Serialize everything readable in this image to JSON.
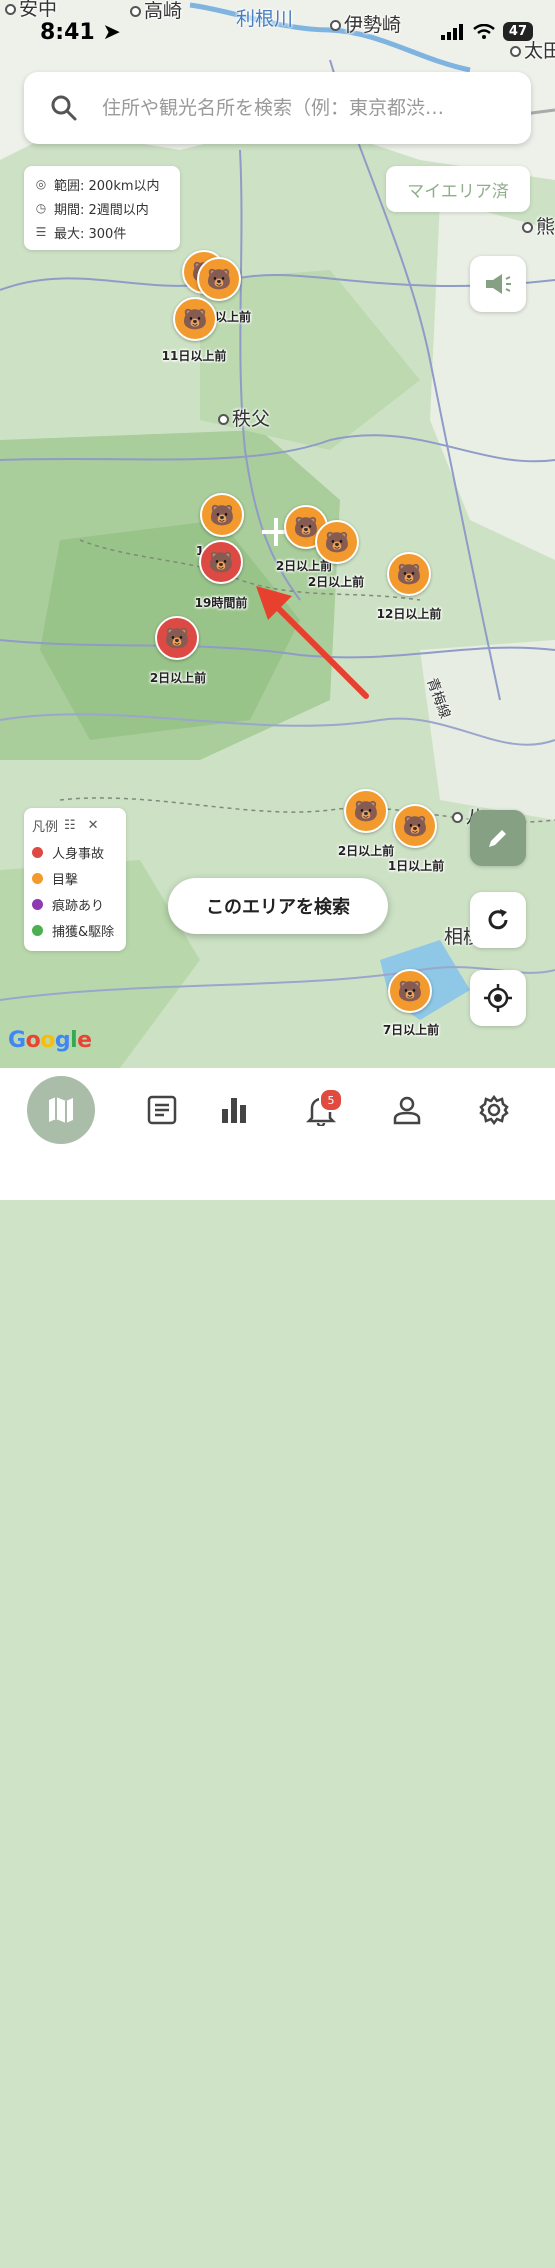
{
  "status": {
    "time": "8:41",
    "battery": "47"
  },
  "search": {
    "placeholder": "住所や観光名所を検索（例：東京都渋…"
  },
  "filter_info": {
    "range": "範囲: 200km以内",
    "period": "期間: 2週間以内",
    "max": "最大: 300件"
  },
  "my_area_label": "マイエリア済",
  "places": [
    {
      "name": "安中"
    },
    {
      "name": "高崎"
    },
    {
      "name": "利根川"
    },
    {
      "name": "伊勢崎"
    },
    {
      "name": "太田"
    },
    {
      "name": "熊"
    },
    {
      "name": "秩父"
    },
    {
      "name": "青梅線"
    },
    {
      "name": "相模"
    },
    {
      "name": "八"
    }
  ],
  "markers": [
    {
      "type": "orange",
      "label": ""
    },
    {
      "type": "orange",
      "label": "以上前"
    },
    {
      "type": "orange",
      "label": "11日以上前"
    },
    {
      "type": "orange",
      "label": "1"
    },
    {
      "type": "orange",
      "label": "2日以上前"
    },
    {
      "type": "orange",
      "label": "2日以上前"
    },
    {
      "type": "red",
      "label": "19時間前"
    },
    {
      "type": "orange",
      "label": "12日以上前"
    },
    {
      "type": "red",
      "label": "2日以上前"
    },
    {
      "type": "orange",
      "label": "2日以上前"
    },
    {
      "type": "orange",
      "label": "1日以上前"
    },
    {
      "type": "orange",
      "label": "7日以上前"
    }
  ],
  "legend": {
    "title": "凡例",
    "items": [
      {
        "label": "人身事故",
        "color": "#dd4a44"
      },
      {
        "label": "目撃",
        "color": "#f29a2e"
      },
      {
        "label": "痕跡あり",
        "color": "#8e3ab0"
      },
      {
        "label": "捕獲&駆除",
        "color": "#4caf50"
      }
    ]
  },
  "search_area_button": "このエリアを検索",
  "google_logo": "Google",
  "nav": {
    "notification_count": "5"
  }
}
